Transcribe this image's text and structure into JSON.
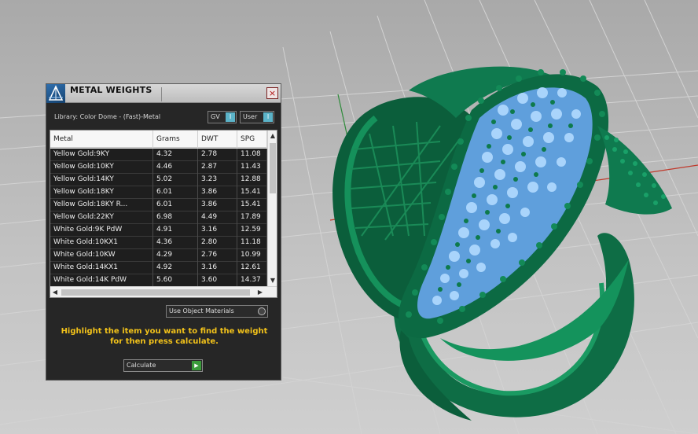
{
  "viewport": {
    "background": "#bdbdbd",
    "grid_color": "#d6d6d6",
    "axis_x_color": "#c0392b",
    "axis_y_color": "#2e8b3a",
    "ring_color": "#0f7a4f",
    "stone_color": "#7fb8f0"
  },
  "panel": {
    "title": "METAL WEIGHTS",
    "logo_icon": "app-logo-icon",
    "close_label": "×",
    "library_label": "Library: Color Dome - (Fast)-Metal",
    "toggle_gv": "GV",
    "toggle_user": "User",
    "toggle_knob": "I",
    "accent": "#f2c21a"
  },
  "table": {
    "columns": [
      "Metal",
      "Grams",
      "DWT",
      "SPG"
    ],
    "rows": [
      [
        "Yellow Gold:9KY",
        "4.32",
        "2.78",
        "11.08"
      ],
      [
        "Yellow Gold:10KY",
        "4.46",
        "2.87",
        "11.43"
      ],
      [
        "Yellow Gold:14KY",
        "5.02",
        "3.23",
        "12.88"
      ],
      [
        "Yellow Gold:18KY",
        "6.01",
        "3.86",
        "15.41"
      ],
      [
        "Yellow Gold:18KY R...",
        "6.01",
        "3.86",
        "15.41"
      ],
      [
        "Yellow Gold:22KY",
        "6.98",
        "4.49",
        "17.89"
      ],
      [
        "White Gold:9K PdW",
        "4.91",
        "3.16",
        "12.59"
      ],
      [
        "White Gold:10KX1",
        "4.36",
        "2.80",
        "11.18"
      ],
      [
        "White Gold:10KW",
        "4.29",
        "2.76",
        "10.99"
      ],
      [
        "White Gold:14KX1",
        "4.92",
        "3.16",
        "12.61"
      ],
      [
        "White Gold:14K PdW",
        "5.60",
        "3.60",
        "14.37"
      ]
    ]
  },
  "controls": {
    "use_object_materials": "Use Object Materials",
    "instruction": "Highlight the item you want to find the weight for then press calculate.",
    "calculate_label": "Calculate"
  }
}
